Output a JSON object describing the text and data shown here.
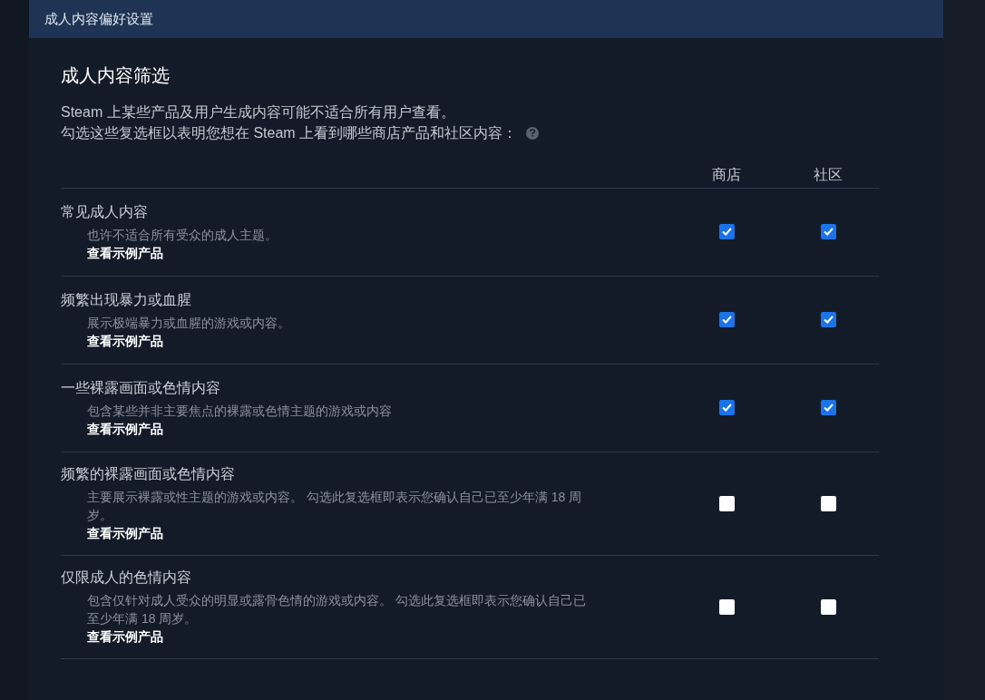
{
  "header": {
    "title": "成人内容偏好设置"
  },
  "section": {
    "title": "成人内容筛选",
    "intro": [
      "Steam 上某些产品及用户生成内容可能不适合所有用户查看。",
      "勾选这些复选框以表明您想在 Steam 上看到哪些商店产品和社区内容："
    ]
  },
  "columns": [
    "商店",
    "社区"
  ],
  "rows": [
    {
      "title": "常见成人内容",
      "description": "也许不适合所有受众的成人主题。",
      "link": "查看示例产品",
      "store_checked": true,
      "community_checked": true
    },
    {
      "title": "频繁出现暴力或血腥",
      "description": "展示极端暴力或血腥的游戏或内容。",
      "link": "查看示例产品",
      "store_checked": true,
      "community_checked": true
    },
    {
      "title": "一些裸露画面或色情内容",
      "description": "包含某些并非主要焦点的裸露或色情主题的游戏或内容",
      "link": "查看示例产品",
      "store_checked": true,
      "community_checked": true
    },
    {
      "title": "频繁的裸露画面或色情内容",
      "description": "主要展示裸露或性主题的游戏或内容。 勾选此复选框即表示您确认自己已至少年满 18 周岁。",
      "link": "查看示例产品",
      "store_checked": false,
      "community_checked": false
    },
    {
      "title": "仅限成人的色情内容",
      "description": "包含仅针对成人受众的明显或露骨色情的游戏或内容。 勾选此复选框即表示您确认自己已至少年满 18 周岁。",
      "link": "查看示例产品",
      "store_checked": false,
      "community_checked": false
    }
  ]
}
